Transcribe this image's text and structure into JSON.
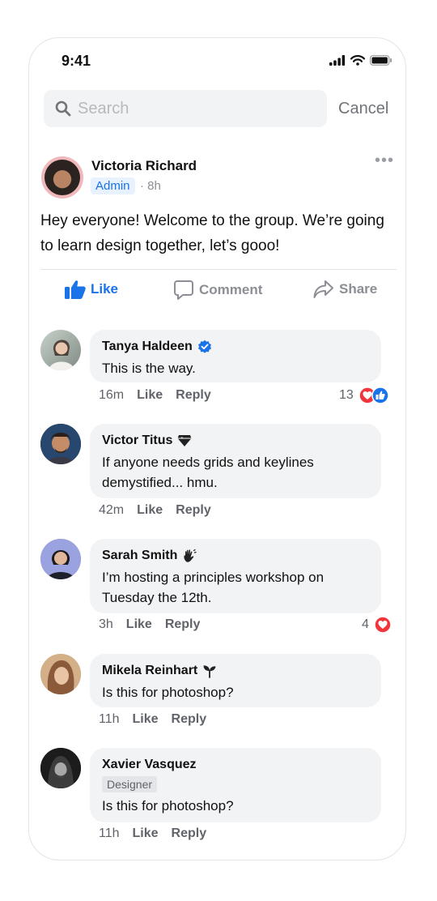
{
  "status": {
    "time": "9:41"
  },
  "search": {
    "placeholder": "Search",
    "cancel_label": "Cancel"
  },
  "post": {
    "author": "Victoria Richard",
    "badge": "Admin",
    "time": "· 8h",
    "text": "Hey everyone! Welcome to the group. We’re going to learn design together, let’s gooo!",
    "actions": {
      "like": "Like",
      "comment": "Comment",
      "share": "Share"
    }
  },
  "comments": [
    {
      "name": "Tanya Haldeen",
      "badge_icon": "verified-badge-icon",
      "text": "This is the way.",
      "time": "16m",
      "like": "Like",
      "reply": "Reply",
      "reaction_count": "13"
    },
    {
      "name": "Victor Titus",
      "badge_icon": "diamond-heart-icon",
      "text": "If anyone needs grids and keylines demystified... hmu.",
      "time": "42m",
      "like": "Like",
      "reply": "Reply"
    },
    {
      "name": "Sarah Smith",
      "badge_icon": "waving-hand-icon",
      "text": "I’m hosting a principles workshop on Tuesday the 12th.",
      "time": "3h",
      "like": "Like",
      "reply": "Reply",
      "reaction_count": "4"
    },
    {
      "name": "Mikela Reinhart",
      "badge_icon": "plant-icon",
      "text": "Is this for photoshop?",
      "time": "11h",
      "like": "Like",
      "reply": "Reply"
    },
    {
      "name": "Xavier Vasquez",
      "tag": "Designer",
      "text": "Is this for photoshop?",
      "time": "11h",
      "like": "Like",
      "reply": "Reply"
    }
  ],
  "colors": {
    "accent": "#1a73e8",
    "love": "#f0353d",
    "bubble": "#f2f3f5"
  }
}
